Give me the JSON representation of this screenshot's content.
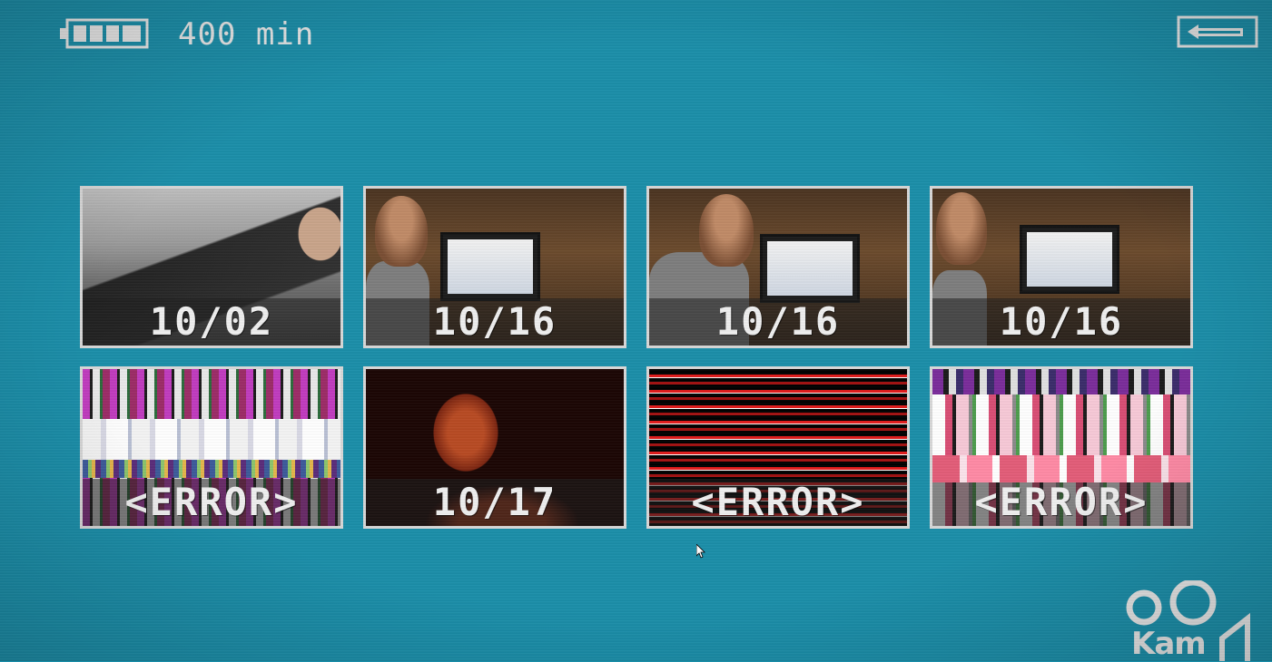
{
  "status_bar": {
    "battery_level": 1.0,
    "battery_icon": "battery-full-icon",
    "time_remaining": "400 min"
  },
  "back_button": {
    "icon": "back-arrow-icon"
  },
  "thumbnails": [
    {
      "caption": "10/02",
      "image": "man-in-car-with-bag"
    },
    {
      "caption": "10/16",
      "image": "man-at-computer-desk"
    },
    {
      "caption": "10/16",
      "image": "man-at-computer-desk"
    },
    {
      "caption": "10/16",
      "image": "man-at-computer-desk"
    },
    {
      "caption": "<ERROR>",
      "image": "glitch-noise"
    },
    {
      "caption": "10/17",
      "image": "man-in-red-light"
    },
    {
      "caption": "<ERROR>",
      "image": "glitch-noise-red"
    },
    {
      "caption": "<ERROR>",
      "image": "glitch-noise"
    }
  ],
  "logo": {
    "text": "Kam",
    "icon": "kamcorder-logo-icon"
  },
  "colors": {
    "background": "#1a8ea9",
    "foreground": "#e9e9e9",
    "thumbnail_border": "#d8d8d8"
  }
}
